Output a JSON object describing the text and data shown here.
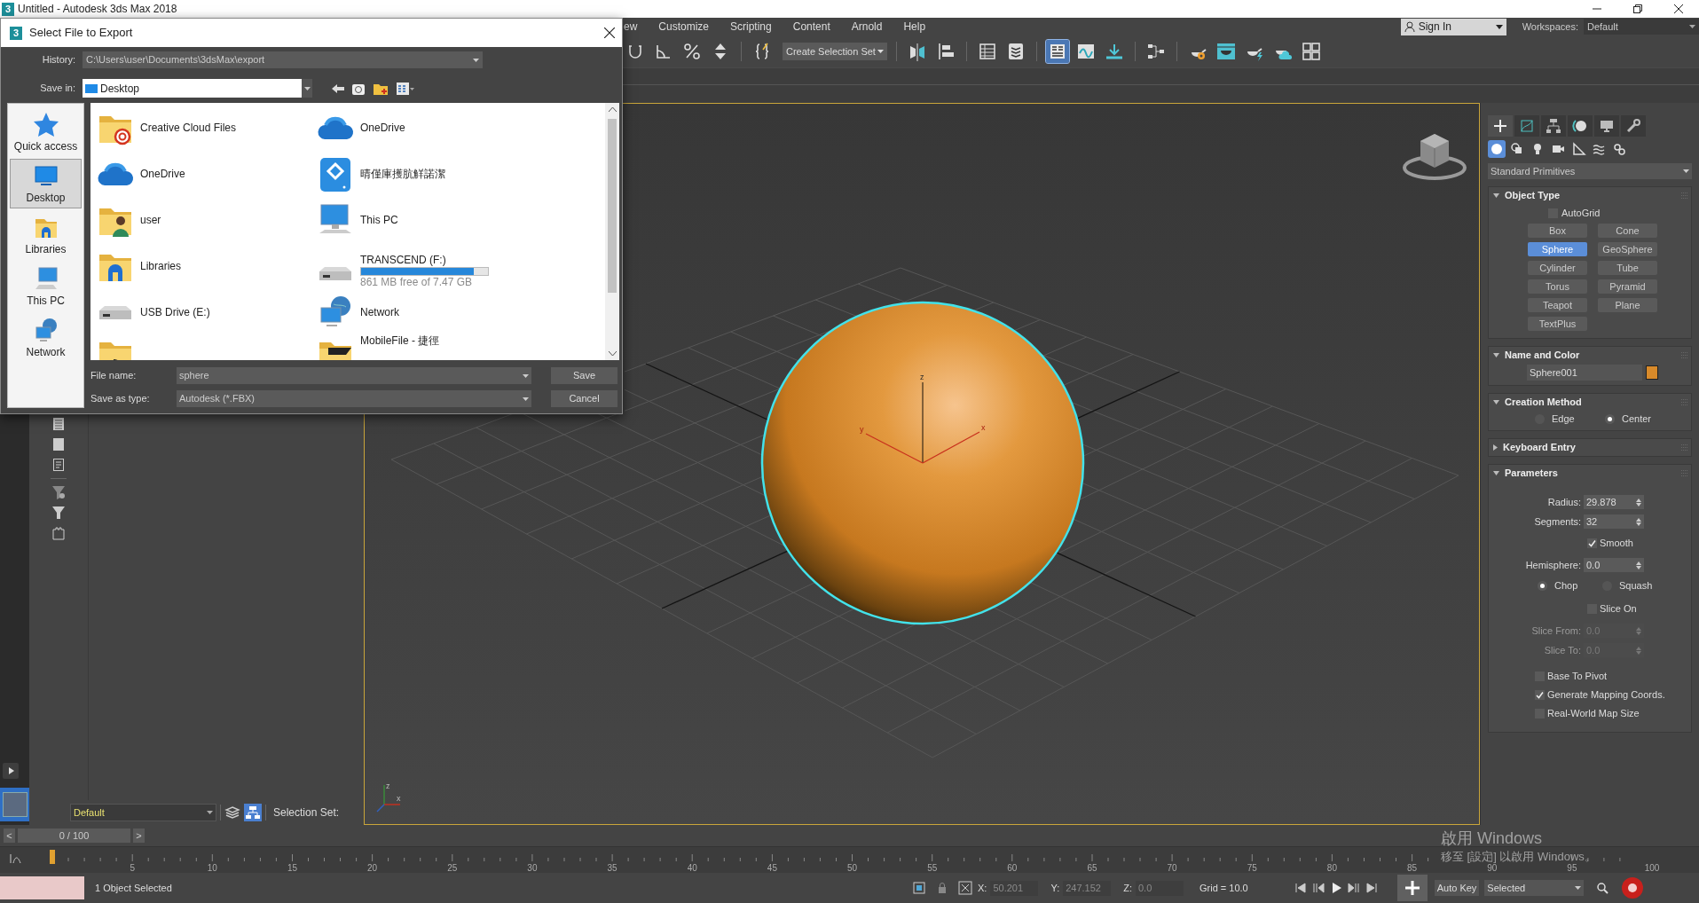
{
  "app": {
    "logo": "3",
    "title": "Untitled - Autodesk 3ds Max 2018"
  },
  "menu": [
    "ew",
    "Customize",
    "Scripting",
    "Content",
    "Arnold",
    "Help"
  ],
  "sign_in": "Sign In",
  "workspaces": {
    "label": "Workspaces:",
    "value": "Default"
  },
  "toolbar": {
    "selection_set": "Create Selection Set",
    "buttons": [
      {
        "selected": false
      },
      {
        "selected": false
      },
      {
        "selected": false
      },
      {
        "selected": false
      },
      {
        "selected": false
      },
      {
        "selected": false
      },
      {
        "selected": false
      },
      {
        "selected": false
      },
      {
        "selected": false
      },
      {
        "selected": true
      },
      {
        "selected": false
      },
      {
        "selected": false
      },
      {
        "selected": false
      },
      {
        "selected": false
      },
      {
        "selected": false
      },
      {
        "selected": false
      },
      {
        "selected": false
      },
      {
        "selected": false
      }
    ]
  },
  "dialog": {
    "logo": "3",
    "title": "Select File to Export",
    "history_label": "History:",
    "history": "C:\\Users\\user\\Documents\\3dsMax\\export",
    "save_in_label": "Save in:",
    "save_in": "Desktop",
    "places": [
      {
        "label": "Quick access",
        "kind": "star",
        "selected": false
      },
      {
        "label": "Desktop",
        "kind": "desktop",
        "selected": true
      },
      {
        "label": "Libraries",
        "kind": "libraries",
        "selected": false
      },
      {
        "label": "This PC",
        "kind": "pc",
        "selected": false
      },
      {
        "label": "Network",
        "kind": "network",
        "selected": false
      }
    ],
    "files": [
      {
        "label": "Creative Cloud Files",
        "kind": "cc-folder"
      },
      {
        "label": "OneDrive",
        "kind": "cloud"
      },
      {
        "label": "OneDrive",
        "kind": "cloud"
      },
      {
        "label": "晴僅庫擭肮觧諾潔",
        "kind": "app"
      },
      {
        "label": "user",
        "kind": "user-folder"
      },
      {
        "label": "This PC",
        "kind": "pc"
      },
      {
        "label": "Libraries",
        "kind": "libraries"
      },
      {
        "label": "TRANSCEND (F:)",
        "kind": "drive",
        "level": 0.885,
        "detail": "861 MB free of 7.47 GB"
      },
      {
        "label": "USB Drive (E:)",
        "kind": "drive"
      },
      {
        "label": "Network",
        "kind": "network"
      },
      {
        "kind": "folder"
      },
      {
        "label": "MobileFile - 捷徑",
        "kind": "shortcut"
      }
    ],
    "file_name_label": "File name:",
    "file_name": "sphere",
    "type_label": "Save as type:",
    "type": "Autodesk (*.FBX)",
    "buttons": [
      "Save",
      "Cancel"
    ]
  },
  "viewport": {
    "active": true,
    "gizmo_labels": [
      "z",
      "y",
      "x"
    ],
    "tripod_labels": [
      "z",
      "x"
    ]
  },
  "command_panel": {
    "tabs": [
      {
        "selected": true
      },
      {
        "selected": false
      },
      {
        "selected": false
      },
      {
        "selected": false
      },
      {
        "selected": false
      },
      {
        "selected": false
      }
    ],
    "subtabs": [
      {
        "selected": true
      },
      {
        "selected": false
      },
      {
        "selected": false
      },
      {
        "selected": false
      },
      {
        "selected": false
      },
      {
        "selected": false
      },
      {
        "selected": false
      }
    ],
    "category": "Standard Primitives",
    "rollouts": [
      {
        "kind": "object_type",
        "title": "Object Type",
        "expanded": true,
        "autogrid": {
          "label": "AutoGrid",
          "checked": false
        },
        "buttons": [
          {
            "label": "Box",
            "selected": false
          },
          {
            "label": "Cone",
            "selected": false
          },
          {
            "label": "Sphere",
            "selected": true
          },
          {
            "label": "GeoSphere",
            "selected": false
          },
          {
            "label": "Cylinder",
            "selected": false
          },
          {
            "label": "Tube",
            "selected": false
          },
          {
            "label": "Torus",
            "selected": false
          },
          {
            "label": "Pyramid",
            "selected": false
          },
          {
            "label": "Teapot",
            "selected": false
          },
          {
            "label": "Plane",
            "selected": false
          },
          {
            "label": "TextPlus",
            "selected": false
          }
        ]
      },
      {
        "kind": "name_color",
        "title": "Name and Color",
        "expanded": true,
        "name": "Sphere001",
        "color": "#d88a2a"
      },
      {
        "kind": "creation",
        "title": "Creation Method",
        "expanded": true,
        "options": [
          {
            "label": "Edge",
            "selected": false
          },
          {
            "label": "Center",
            "selected": true
          }
        ]
      },
      {
        "kind": "keyboard",
        "title": "Keyboard Entry",
        "expanded": false
      },
      {
        "kind": "parameters",
        "title": "Parameters",
        "expanded": true,
        "rows": [
          {
            "kind": "spinner",
            "label": "Radius:",
            "value": "29.878",
            "disabled": false
          },
          {
            "kind": "spinner",
            "label": "Segments:",
            "value": "32",
            "disabled": false
          },
          {
            "kind": "toggle",
            "label": "Smooth",
            "checked": true
          },
          {
            "kind": "spinner",
            "label": "Hemisphere:",
            "value": "0.0",
            "disabled": false
          },
          {
            "kind": "radios",
            "options": [
              {
                "label": "Chop",
                "selected": true
              },
              {
                "label": "Squash",
                "selected": false
              }
            ]
          },
          {
            "kind": "toggle",
            "label": "Slice On",
            "checked": false
          },
          {
            "kind": "spinner",
            "label": "Slice From:",
            "value": "0.0",
            "disabled": true
          },
          {
            "kind": "spinner",
            "label": "Slice To:",
            "value": "0.0",
            "disabled": true
          },
          {
            "kind": "checkbox",
            "label": "Base To Pivot",
            "checked": false
          },
          {
            "kind": "checkbox",
            "label": "Generate Mapping Coords.",
            "checked": true
          },
          {
            "kind": "checkbox",
            "label": "Real-World Map Size",
            "checked": false
          }
        ]
      }
    ]
  },
  "layer_bar": {
    "layer": "Default",
    "selection_set_label": "Selection Set:"
  },
  "time_slider": {
    "prev": "<",
    "frame": "0 / 100",
    "next": ">",
    "level": 0
  },
  "track": {
    "labels": [
      "5",
      "10",
      "15",
      "20",
      "25",
      "30",
      "35",
      "40",
      "45",
      "50",
      "55",
      "60",
      "65",
      "70",
      "75",
      "80",
      "85",
      "90",
      "95",
      "100"
    ]
  },
  "status": {
    "message": "1 Object Selected",
    "coords": [
      {
        "label": "X:",
        "value": "50.201"
      },
      {
        "label": "Y:",
        "value": "247.152"
      },
      {
        "label": "Z:",
        "value": "0.0"
      }
    ],
    "grid": "Grid = 10.0",
    "auto_key": "Auto Key",
    "key_filter": "Selected"
  },
  "activation": {
    "title": "啟用 Windows",
    "hint": "移至 [設定] 以啟用 Windows。"
  }
}
